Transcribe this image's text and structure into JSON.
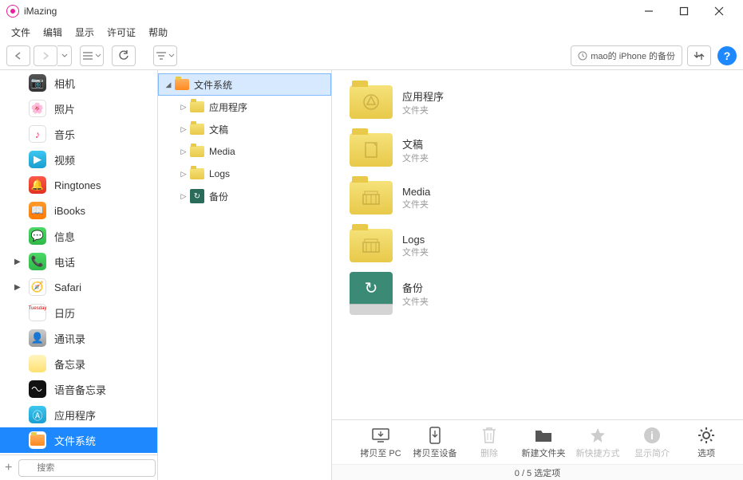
{
  "window": {
    "title": "iMazing"
  },
  "menu": {
    "items": [
      "文件",
      "编辑",
      "显示",
      "许可证",
      "帮助"
    ]
  },
  "toolbar": {
    "backup_label": "mao的 iPhone 的备份"
  },
  "sidebar": {
    "items": [
      {
        "label": "相机",
        "icon": "camera",
        "expandable": false
      },
      {
        "label": "照片",
        "icon": "photos",
        "expandable": false
      },
      {
        "label": "音乐",
        "icon": "music",
        "expandable": false
      },
      {
        "label": "视频",
        "icon": "video",
        "expandable": false
      },
      {
        "label": "Ringtones",
        "icon": "ring",
        "expandable": false
      },
      {
        "label": "iBooks",
        "icon": "ibooks",
        "expandable": false
      },
      {
        "label": "信息",
        "icon": "msg",
        "expandable": false
      },
      {
        "label": "电话",
        "icon": "phone",
        "expandable": true
      },
      {
        "label": "Safari",
        "icon": "safari",
        "expandable": true
      },
      {
        "label": "日历",
        "icon": "cal",
        "expandable": false
      },
      {
        "label": "通讯录",
        "icon": "contacts",
        "expandable": false
      },
      {
        "label": "备忘录",
        "icon": "notes",
        "expandable": false
      },
      {
        "label": "语音备忘录",
        "icon": "voice",
        "expandable": false
      },
      {
        "label": "应用程序",
        "icon": "appstore",
        "expandable": false
      },
      {
        "label": "文件系统",
        "icon": "fs",
        "expandable": false,
        "selected": true
      }
    ],
    "search_placeholder": "搜索"
  },
  "tree": {
    "root": {
      "label": "文件系统",
      "expanded": true
    },
    "children": [
      {
        "label": "应用程序",
        "icon": "folder"
      },
      {
        "label": "文稿",
        "icon": "folder"
      },
      {
        "label": "Media",
        "icon": "folder"
      },
      {
        "label": "Logs",
        "icon": "folder"
      },
      {
        "label": "备份",
        "icon": "backup"
      }
    ]
  },
  "grid": {
    "items": [
      {
        "name": "应用程序",
        "type": "文件夹",
        "icon": "apps"
      },
      {
        "name": "文稿",
        "type": "文件夹",
        "icon": "docs"
      },
      {
        "name": "Media",
        "type": "文件夹",
        "icon": "media"
      },
      {
        "name": "Logs",
        "type": "文件夹",
        "icon": "logs"
      },
      {
        "name": "备份",
        "type": "文件夹",
        "icon": "backup"
      }
    ]
  },
  "bottom": {
    "items": [
      {
        "label": "拷贝至 PC",
        "icon": "copy-pc",
        "enabled": true
      },
      {
        "label": "拷贝至设备",
        "icon": "copy-dev",
        "enabled": true
      },
      {
        "label": "删除",
        "icon": "trash",
        "enabled": false
      },
      {
        "label": "新建文件夹",
        "icon": "newfolder",
        "enabled": true
      },
      {
        "label": "新快捷方式",
        "icon": "star",
        "enabled": false
      },
      {
        "label": "显示简介",
        "icon": "info",
        "enabled": false
      },
      {
        "label": "选项",
        "icon": "gear",
        "enabled": true
      }
    ]
  },
  "status": {
    "text": "0 / 5 选定项"
  }
}
